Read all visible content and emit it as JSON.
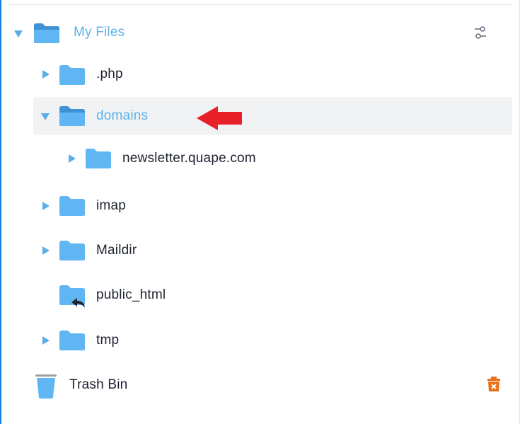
{
  "tree": {
    "root": {
      "label": "My Files"
    },
    "items": [
      {
        "label": ".php"
      },
      {
        "label": "domains"
      },
      {
        "label": "newsletter.quape.com"
      },
      {
        "label": "imap"
      },
      {
        "label": "Maildir"
      },
      {
        "label": "public_html"
      },
      {
        "label": "tmp"
      }
    ],
    "trash": {
      "label": "Trash Bin"
    }
  },
  "icons": {
    "folder": "folder-icon",
    "symlink": "folder-symlink-icon",
    "settings": "settings-icon",
    "trash": "trash-bin-icon",
    "empty_trash": "empty-trash-icon",
    "annotation": "red-arrow-icon"
  },
  "colors": {
    "accent": "#5eb2e9",
    "folder": "#5fb6f2",
    "folder_dark": "#3f92d6",
    "text": "#1d2230",
    "highlight": "#f1f2f4",
    "arrow": "#e8202a",
    "trash_action": "#e8711b"
  }
}
